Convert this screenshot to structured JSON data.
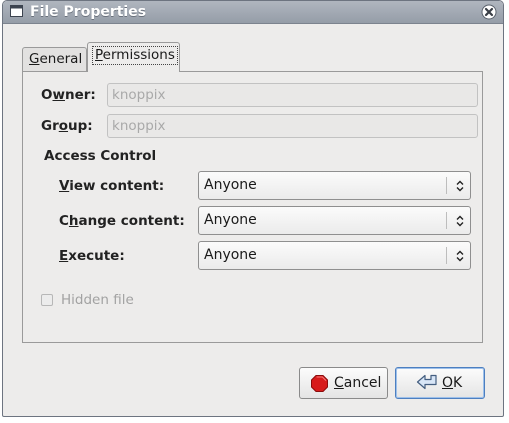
{
  "window": {
    "title": "File Properties",
    "icons": {
      "window": "window-icon",
      "close": "close-icon"
    }
  },
  "tabs": [
    {
      "prefix": "",
      "mnemonic": "G",
      "rest": "eneral",
      "selected": false
    },
    {
      "prefix": "",
      "mnemonic": "P",
      "rest": "ermissions",
      "selected": true
    }
  ],
  "owner": {
    "label_prefix": "O",
    "label_mnemonic": "w",
    "label_rest": "ner:",
    "value": "knoppix"
  },
  "group": {
    "label_prefix": "Gr",
    "label_mnemonic": "o",
    "label_rest": "up:",
    "value": "knoppix"
  },
  "access_control": {
    "heading": "Access Control",
    "rows": [
      {
        "label_prefix": "",
        "label_mnemonic": "V",
        "label_rest": "iew content:",
        "value": "Anyone"
      },
      {
        "label_prefix": "C",
        "label_mnemonic": "h",
        "label_rest": "ange content:",
        "value": "Anyone"
      },
      {
        "label_prefix": "",
        "label_mnemonic": "E",
        "label_rest": "xecute:",
        "value": "Anyone"
      }
    ]
  },
  "hidden_file": {
    "label": "Hidden file",
    "checked": false,
    "enabled": false
  },
  "buttons": {
    "cancel": {
      "mnemonic": "C",
      "rest": "ancel",
      "icon": "stop-icon"
    },
    "ok": {
      "mnemonic": "O",
      "rest": "K",
      "icon": "return-arrow-icon"
    }
  },
  "colors": {
    "titlebar": "#a1a8b2",
    "window_bg": "#edeceb",
    "default_button_border": "#4d7fc0",
    "stop_red": "#d71b1b"
  }
}
